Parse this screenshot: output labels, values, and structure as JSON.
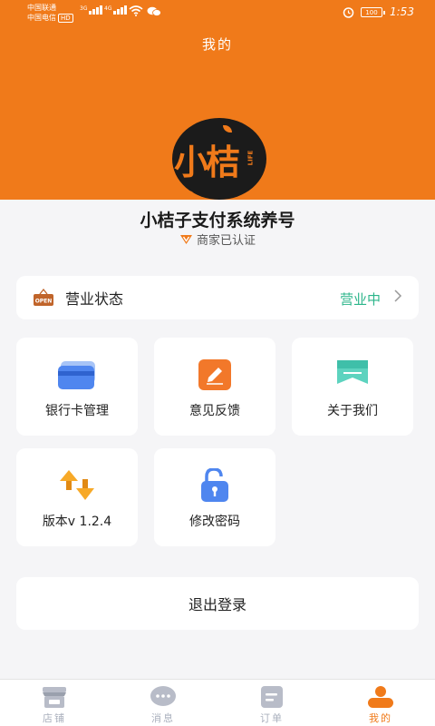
{
  "status_bar": {
    "carrier1": "中国联通",
    "carrier2": "中国电信",
    "hd": "HD",
    "net1": "3G",
    "net2": "4G",
    "battery": "100",
    "time": "1:53"
  },
  "header": {
    "title": "我的"
  },
  "profile": {
    "logo_text": "小桔3",
    "logo_sub": "LIFE",
    "name": "小桔子支付系统养号",
    "verified_label": "商家已认证"
  },
  "business_status": {
    "icon": "open-sign-icon",
    "badge": "OPEN",
    "label": "营业状态",
    "value": "营业中",
    "value_color": "#2bb58a"
  },
  "tiles": [
    {
      "icon": "bank-card-icon",
      "label": "银行卡管理"
    },
    {
      "icon": "edit-pencil-icon",
      "label": "意见反馈"
    },
    {
      "icon": "about-flag-icon",
      "label": "关于我们"
    },
    {
      "icon": "version-arrows-icon",
      "label": "版本v 1.2.4"
    },
    {
      "icon": "lock-icon",
      "label": "修改密码"
    }
  ],
  "logout_label": "退出登录",
  "tabbar": {
    "items": [
      {
        "icon": "store-icon",
        "label": "店铺",
        "active": false
      },
      {
        "icon": "message-icon",
        "label": "消息",
        "active": false
      },
      {
        "icon": "order-icon",
        "label": "订单",
        "active": false
      },
      {
        "icon": "profile-icon",
        "label": "我的",
        "active": true
      }
    ]
  },
  "colors": {
    "brand": "#f07a1a",
    "inactive": "#aab0bd",
    "accent_green": "#2bb58a"
  }
}
